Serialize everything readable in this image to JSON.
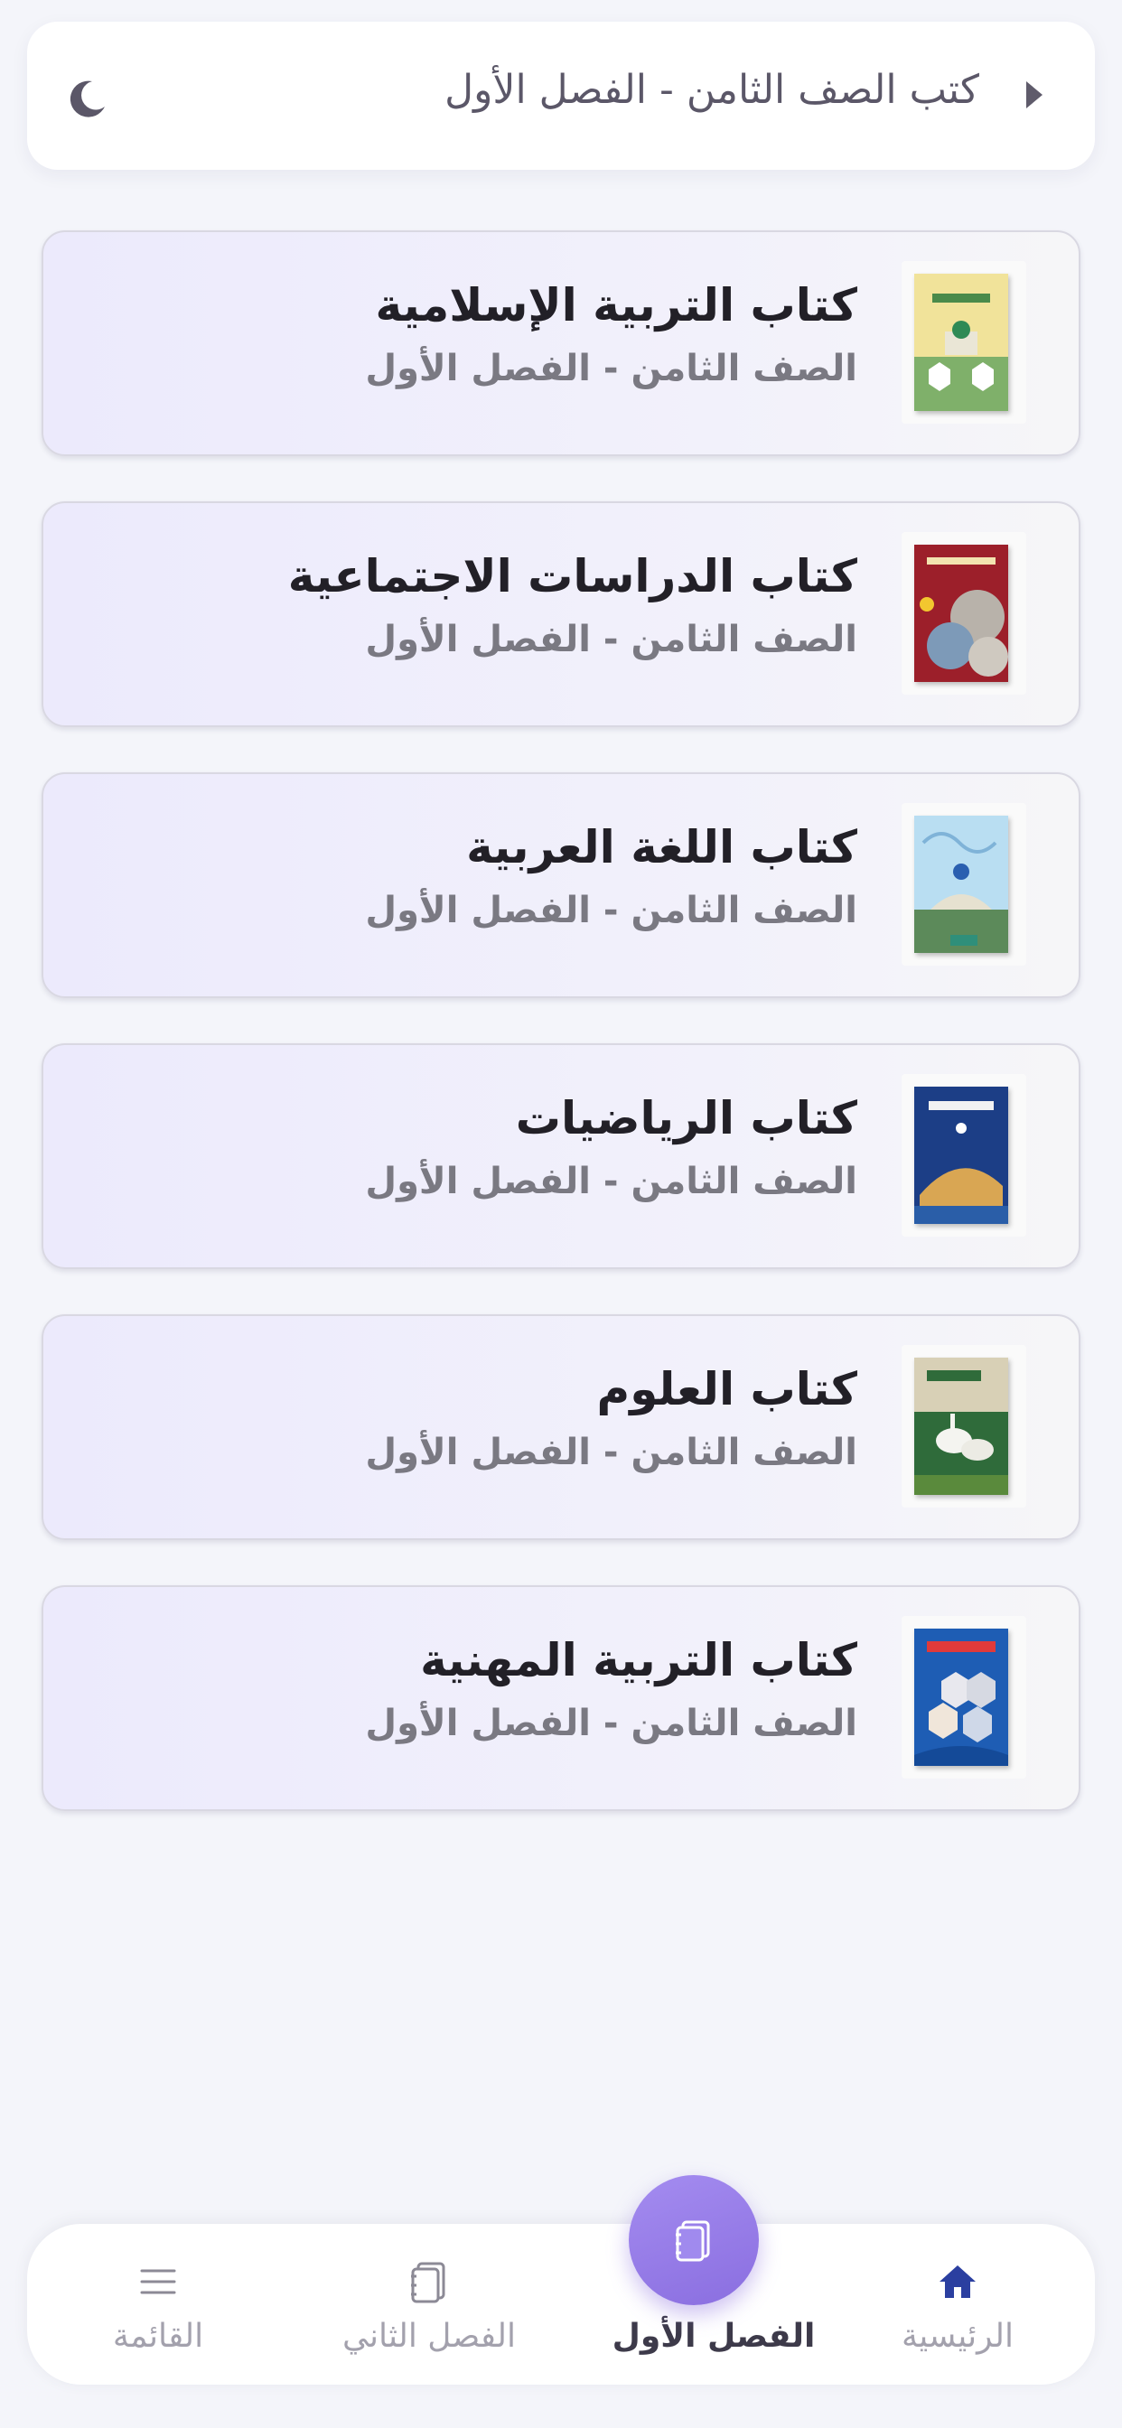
{
  "header": {
    "title": "كتب الصف الثامن - الفصل الأول",
    "back_icon": "caret-right-icon",
    "theme_icon": "moon-icon"
  },
  "books": [
    {
      "title": "كتاب التربية الإسلامية",
      "subtitle": "الصف الثامن - الفصل الأول",
      "cover_colors": [
        "#f1e39a",
        "#7fb06a"
      ]
    },
    {
      "title": "كتاب الدراسات الاجتماعية",
      "subtitle": "الصف الثامن - الفصل الأول",
      "cover_colors": [
        "#9c1f2a",
        "#c9c4bd"
      ]
    },
    {
      "title": "كتاب اللغة العربية",
      "subtitle": "الصف الثامن - الفصل الأول",
      "cover_colors": [
        "#b9def2",
        "#5c8a5a"
      ]
    },
    {
      "title": "كتاب الرياضيات",
      "subtitle": "الصف الثامن - الفصل الأول",
      "cover_colors": [
        "#1c3e86",
        "#d9a653"
      ]
    },
    {
      "title": "كتاب العلوم",
      "subtitle": "الصف الثامن - الفصل الأول",
      "cover_colors": [
        "#2f6b3a",
        "#d8d0b6"
      ]
    },
    {
      "title": "كتاب التربية المهنية",
      "subtitle": "الصف الثامن - الفصل الأول",
      "cover_colors": [
        "#1e5db4",
        "#e8e8ee"
      ]
    }
  ],
  "nav": {
    "home": {
      "label": "الرئيسية",
      "icon": "home-icon"
    },
    "first": {
      "label": "الفصل الأول",
      "icon": "notebook-icon"
    },
    "second": {
      "label": "الفصل الثاني",
      "icon": "notebook-icon"
    },
    "menu": {
      "label": "القائمة",
      "icon": "menu-icon"
    }
  },
  "colors": {
    "accent": "#9179ea",
    "home_icon": "#2b3fa0",
    "background": "#f4f5fa"
  }
}
